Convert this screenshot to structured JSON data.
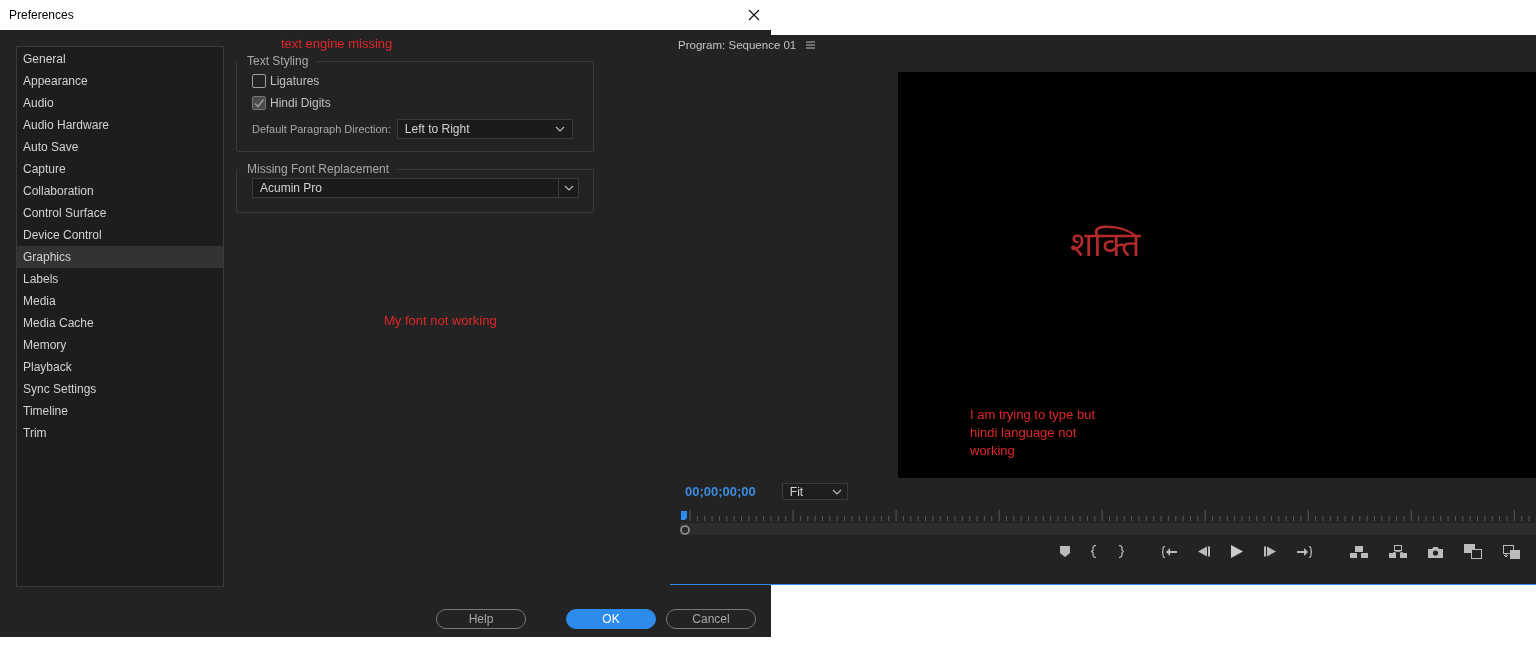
{
  "dialog": {
    "title": "Preferences",
    "sidebar": {
      "items": [
        {
          "label": "General",
          "selected": false
        },
        {
          "label": "Appearance",
          "selected": false
        },
        {
          "label": "Audio",
          "selected": false
        },
        {
          "label": "Audio Hardware",
          "selected": false
        },
        {
          "label": "Auto Save",
          "selected": false
        },
        {
          "label": "Capture",
          "selected": false
        },
        {
          "label": "Collaboration",
          "selected": false
        },
        {
          "label": "Control Surface",
          "selected": false
        },
        {
          "label": "Device Control",
          "selected": false
        },
        {
          "label": "Graphics",
          "selected": true
        },
        {
          "label": "Labels",
          "selected": false
        },
        {
          "label": "Media",
          "selected": false
        },
        {
          "label": "Media Cache",
          "selected": false
        },
        {
          "label": "Memory",
          "selected": false
        },
        {
          "label": "Playback",
          "selected": false
        },
        {
          "label": "Sync Settings",
          "selected": false
        },
        {
          "label": "Timeline",
          "selected": false
        },
        {
          "label": "Trim",
          "selected": false
        }
      ]
    },
    "annotation_top": "text engine missing",
    "text_styling": {
      "title": "Text Styling",
      "checkboxes": [
        {
          "label": "Ligatures",
          "checked": false,
          "disabled": false
        },
        {
          "label": "Hindi Digits",
          "checked": true,
          "disabled": true
        }
      ],
      "direction": {
        "label": "Default Paragraph Direction:",
        "value": "Left to Right"
      }
    },
    "missing_font": {
      "title": "Missing Font Replacement",
      "value": "Acumin Pro"
    },
    "annotation_middle": "My font not working",
    "buttons": [
      {
        "label": "Help",
        "kind": "secondary"
      },
      {
        "label": "OK",
        "kind": "primary"
      },
      {
        "label": "Cancel",
        "kind": "secondary"
      }
    ]
  },
  "monitor": {
    "title": "Program: Sequence 01",
    "video": {
      "text": "शक्ति",
      "annotation": "I am trying to type but hindi language not working"
    },
    "timecode": "00;00;00;00",
    "zoom": {
      "value": "Fit"
    }
  }
}
